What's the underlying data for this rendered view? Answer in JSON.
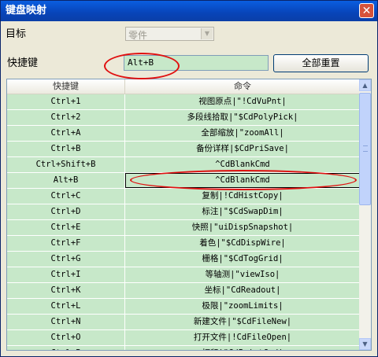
{
  "window": {
    "title": "键盘映射",
    "close_symbol": "✕"
  },
  "target": {
    "label": "目标",
    "combo_value": "零件",
    "arrow": "▼"
  },
  "shortcut": {
    "label": "快捷键",
    "value": "Alt+B",
    "reset_label": "全部重置"
  },
  "table": {
    "columns": [
      "快捷键",
      "命令"
    ],
    "rows": [
      {
        "key": "Ctrl+1",
        "cmd": "视图原点|\"!CdVuPnt|"
      },
      {
        "key": "Ctrl+2",
        "cmd": "多段线拾取|\"$CdPolyPick|"
      },
      {
        "key": "Ctrl+A",
        "cmd": "全部缩放|\"zoomAll|"
      },
      {
        "key": "Ctrl+B",
        "cmd": "备份详样|$CdPriSave|"
      },
      {
        "key": "Ctrl+Shift+B",
        "cmd": "^CdBlankCmd"
      },
      {
        "key": "Alt+B",
        "cmd": "^CdBlankCmd"
      },
      {
        "key": "Ctrl+C",
        "cmd": "复制|!CdHistCopy|"
      },
      {
        "key": "Ctrl+D",
        "cmd": "标注|\"$CdSwapDim|"
      },
      {
        "key": "Ctrl+E",
        "cmd": "快照|\"uiDispSnapshot|"
      },
      {
        "key": "Ctrl+F",
        "cmd": "着色|\"$CdDispWire|"
      },
      {
        "key": "Ctrl+G",
        "cmd": "栅格|\"$CdTogGrid|"
      },
      {
        "key": "Ctrl+I",
        "cmd": "等轴测|\"viewIso|"
      },
      {
        "key": "Ctrl+K",
        "cmd": "坐标|\"CdReadout|"
      },
      {
        "key": "Ctrl+L",
        "cmd": "极限|\"zoomLimits|"
      },
      {
        "key": "Ctrl+N",
        "cmd": "新建文件|\"$CdFileNew|"
      },
      {
        "key": "Ctrl+O",
        "cmd": "打开文件|!CdFileOpen|"
      },
      {
        "key": "Ctrl+P",
        "cmd": "打印|\"CdPrintCmd|"
      }
    ]
  },
  "scroll": {
    "up": "▲",
    "down": "▼"
  }
}
